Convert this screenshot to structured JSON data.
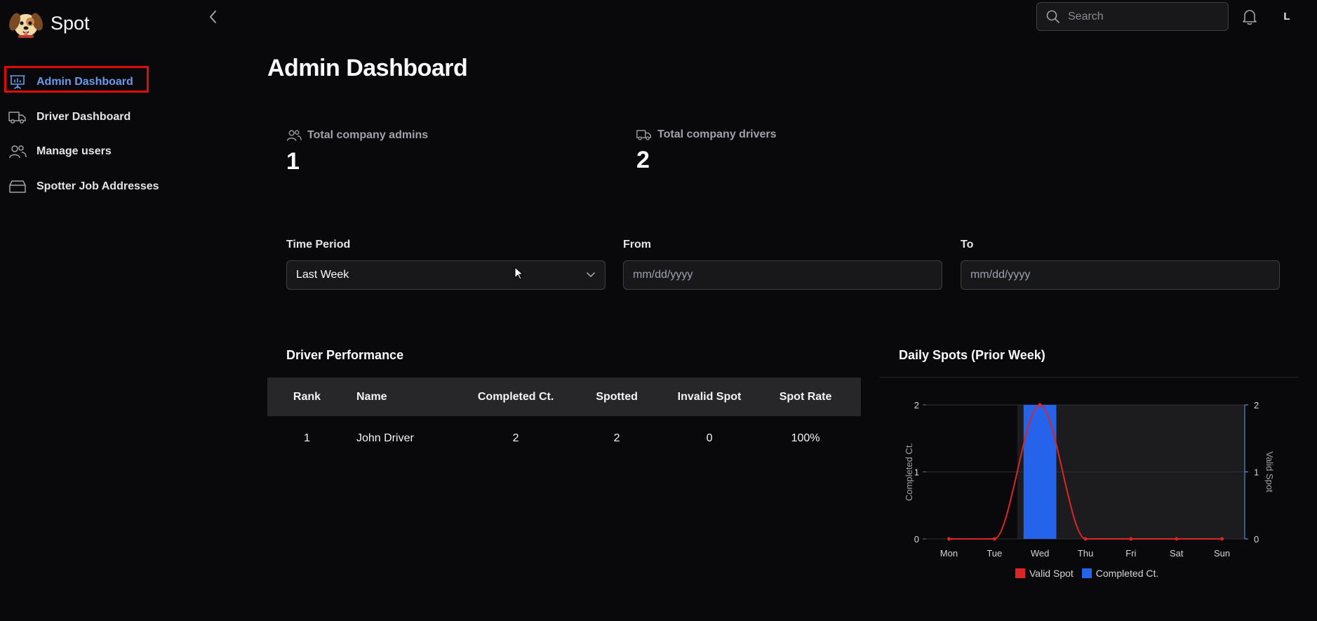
{
  "app": {
    "name": "Spot"
  },
  "sidebar": {
    "items": [
      {
        "label": "Admin Dashboard",
        "icon": "presentation-chart-icon",
        "active": true
      },
      {
        "label": "Driver Dashboard",
        "icon": "truck-icon"
      },
      {
        "label": "Manage users",
        "icon": "users-icon"
      },
      {
        "label": "Spotter Job Addresses",
        "icon": "archive-icon"
      }
    ]
  },
  "topbar": {
    "search_placeholder": "Search",
    "avatar_initial": "L"
  },
  "page": {
    "title": "Admin Dashboard"
  },
  "stats": [
    {
      "label": "Total company admins",
      "value": "1",
      "icon": "users-icon"
    },
    {
      "label": "Total company drivers",
      "value": "2",
      "icon": "truck-icon"
    }
  ],
  "filters": {
    "time_period": {
      "label": "Time Period",
      "value": "Last Week"
    },
    "from": {
      "label": "From",
      "placeholder": "mm/dd/yyyy"
    },
    "to": {
      "label": "To",
      "placeholder": "mm/dd/yyyy"
    }
  },
  "driver_performance": {
    "title": "Driver Performance",
    "columns": [
      "Rank",
      "Name",
      "Completed Ct.",
      "Spotted",
      "Invalid Spot",
      "Spot Rate"
    ],
    "rows": [
      [
        "1",
        "John Driver",
        "2",
        "2",
        "0",
        "100%"
      ]
    ]
  },
  "colors": {
    "accent": "#6b9be8",
    "valid_spot": "#dc2626",
    "completed": "#2563eb",
    "highlight_box": "#e20b0b"
  },
  "chart_data": {
    "type": "bar",
    "title": "Daily Spots (Prior Week)",
    "categories": [
      "Mon",
      "Tue",
      "Wed",
      "Thu",
      "Fri",
      "Sat",
      "Sun"
    ],
    "series": [
      {
        "name": "Completed Ct.",
        "type": "bar",
        "values": [
          0,
          0,
          2,
          0,
          0,
          0,
          0
        ],
        "color": "#2563eb",
        "axis": "left"
      },
      {
        "name": "Valid Spot",
        "type": "line",
        "values": [
          0,
          0,
          2,
          0,
          0,
          0,
          0
        ],
        "color": "#dc2626",
        "axis": "right"
      }
    ],
    "ylabel": "Completed Ct.",
    "y2label": "Valid Spot",
    "ylim": [
      0,
      2
    ],
    "y2lim": [
      0,
      2
    ],
    "yticks": [
      0,
      1,
      2
    ],
    "grid": true,
    "legend": "bottom"
  }
}
